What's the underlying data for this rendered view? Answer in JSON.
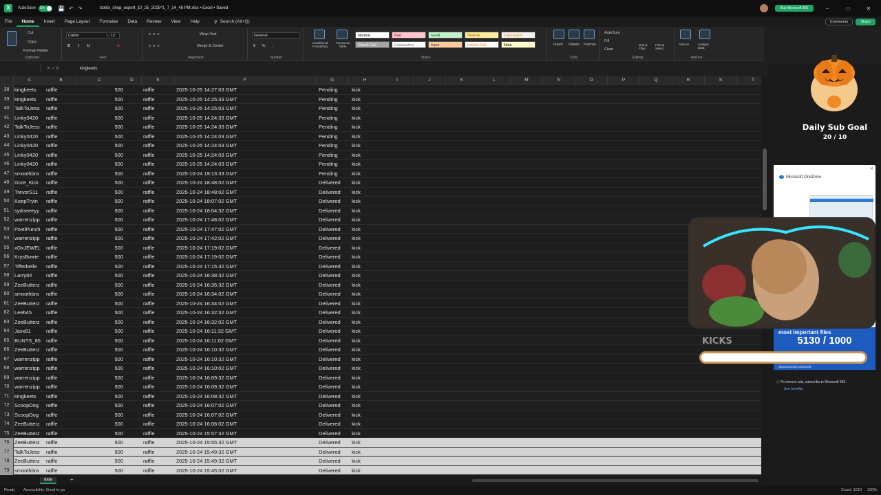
{
  "titlebar": {
    "autosave": "AutoSave",
    "toggle": "On",
    "filename": "botrix_shop_export_10_25_2025^1_7_14_48 PM.xlsx • Excel • Saved",
    "buy": "Buy Microsoft 365",
    "min": "–",
    "max": "□",
    "close": "✕"
  },
  "menu": {
    "tabs": [
      "File",
      "Home",
      "Insert",
      "Page Layout",
      "Formulas",
      "Data",
      "Review",
      "View",
      "Help"
    ],
    "active": "Home",
    "search_placeholder": "Search (Alt+Q)",
    "comments": "Comments",
    "share": "Share"
  },
  "ribbon": {
    "clipboard": {
      "label": "Clipboard",
      "cut": "Cut",
      "copy": "Copy",
      "format_painter": "Format Painter"
    },
    "font": {
      "label": "Font",
      "name": "Calibri",
      "size": "12"
    },
    "alignment": {
      "label": "Alignment",
      "wrap": "Wrap Text",
      "merge": "Merge & Center"
    },
    "number": {
      "label": "Number",
      "format": "General"
    },
    "styles": {
      "label": "Styles",
      "conditional": "Conditional Formatting",
      "format_table": "Format as Table",
      "cells": [
        {
          "name": "Normal",
          "bg": "#ffffff",
          "fg": "#000000"
        },
        {
          "name": "Bad",
          "bg": "#ffc7ce",
          "fg": "#9c0006"
        },
        {
          "name": "Good",
          "bg": "#c6efce",
          "fg": "#006100"
        },
        {
          "name": "Neutral",
          "bg": "#ffeb9c",
          "fg": "#9c5700"
        },
        {
          "name": "Calculation",
          "bg": "#f2f2f2",
          "fg": "#fa7d00"
        },
        {
          "name": "Check Cell",
          "bg": "#a5a5a5",
          "fg": "#ffffff"
        },
        {
          "name": "Explanatory ...",
          "bg": "#ffffff",
          "fg": "#7f7f7f"
        },
        {
          "name": "Input",
          "bg": "#ffcc99",
          "fg": "#3f3f76"
        },
        {
          "name": "Linked Cell",
          "bg": "#ffffff",
          "fg": "#fa7d00"
        },
        {
          "name": "Note",
          "bg": "#ffffcc",
          "fg": "#000000"
        }
      ]
    },
    "cells": {
      "label": "Cells",
      "insert": "Insert",
      "delete": "Delete",
      "format": "Format"
    },
    "editing": {
      "label": "Editing",
      "autosum": "AutoSum",
      "fill": "Fill",
      "clear": "Clear",
      "sort": "Sort & Filter",
      "find": "Find & Select"
    },
    "addins": {
      "label": "Add-ins",
      "addins": "Add-ins",
      "analyze": "Analyze Data"
    }
  },
  "formula": {
    "namebox": "",
    "value": "kingkeets"
  },
  "columns": [
    "A",
    "B",
    "C",
    "D",
    "E",
    "F",
    "G",
    "H",
    "I",
    "J",
    "K",
    "L",
    "M",
    "N",
    "O",
    "P",
    "Q",
    "R",
    "S",
    "T"
  ],
  "rows": [
    {
      "n": "38",
      "a": "kingkeets",
      "b": "raffle",
      "d": "500",
      "e": "raffle",
      "f": "2025-10-25 14:27:03 GMT",
      "g": "Pending",
      "h": "kick"
    },
    {
      "n": "39",
      "a": "kingkeets",
      "b": "raffle",
      "d": "500",
      "e": "raffle",
      "f": "2025-10-25 14:25:33 GMT",
      "g": "Pending",
      "h": "kick"
    },
    {
      "n": "40",
      "a": "TalkToJess",
      "b": "raffle",
      "d": "500",
      "e": "raffle",
      "f": "2025-10-25 14:25:03 GMT",
      "g": "Pending",
      "h": "kick"
    },
    {
      "n": "41",
      "a": "Linky0420",
      "b": "raffle",
      "d": "500",
      "e": "raffle",
      "f": "2025-10-25 14:24:33 GMT",
      "g": "Pending",
      "h": "kick"
    },
    {
      "n": "42",
      "a": "TalkToJess",
      "b": "raffle",
      "d": "500",
      "e": "raffle",
      "f": "2025-10-25 14:24:33 GMT",
      "g": "Pending",
      "h": "kick"
    },
    {
      "n": "43",
      "a": "Linky0420",
      "b": "raffle",
      "d": "500",
      "e": "raffle",
      "f": "2025-10-25 14:24:03 GMT",
      "g": "Pending",
      "h": "kick"
    },
    {
      "n": "44",
      "a": "Linky0420",
      "b": "raffle",
      "d": "500",
      "e": "raffle",
      "f": "2025-10-25 14:24:03 GMT",
      "g": "Pending",
      "h": "kick"
    },
    {
      "n": "45",
      "a": "Linky0420",
      "b": "raffle",
      "d": "500",
      "e": "raffle",
      "f": "2025-10-25 14:24:03 GMT",
      "g": "Pending",
      "h": "kick"
    },
    {
      "n": "46",
      "a": "Linky0420",
      "b": "raffle",
      "d": "500",
      "e": "raffle",
      "f": "2025-10-25 14:24:03 GMT",
      "g": "Pending",
      "h": "kick"
    },
    {
      "n": "47",
      "a": "smoothbra",
      "b": "raffle",
      "d": "500",
      "e": "raffle",
      "f": "2025-10-24 19:13:33 GMT",
      "g": "Pending",
      "h": "kick"
    },
    {
      "n": "48",
      "a": "Gore_Kick",
      "b": "raffle",
      "d": "500",
      "e": "raffle",
      "f": "2025-10-24 18:48:02 GMT",
      "g": "Delivered",
      "h": "kick"
    },
    {
      "n": "49",
      "a": "TrevorS11",
      "b": "raffle",
      "d": "500",
      "e": "raffle",
      "f": "2025-10-24 18:48:02 GMT",
      "g": "Delivered",
      "h": "kick"
    },
    {
      "n": "50",
      "a": "KeepTryin",
      "b": "raffle",
      "d": "500",
      "e": "raffle",
      "f": "2025-10-24 18:07:02 GMT",
      "g": "Delivered",
      "h": "kick"
    },
    {
      "n": "51",
      "a": "sydneeeyy",
      "b": "raffle",
      "d": "500",
      "e": "raffle",
      "f": "2025-10-24 18:04:32 GMT",
      "g": "Delivered",
      "h": "kick"
    },
    {
      "n": "52",
      "a": "warrenzipp",
      "b": "raffle",
      "d": "500",
      "e": "raffle",
      "f": "2025-10-24 17:48:02 GMT",
      "g": "Delivered",
      "h": "kick"
    },
    {
      "n": "53",
      "a": "PixelPunch",
      "b": "raffle",
      "d": "500",
      "e": "raffle",
      "f": "2025-10-24 17:47:02 GMT",
      "g": "Delivered",
      "h": "kick"
    },
    {
      "n": "54",
      "a": "warrenzipp",
      "b": "raffle",
      "d": "500",
      "e": "raffle",
      "f": "2025-10-24 17:42:02 GMT",
      "g": "Delivered",
      "h": "kick"
    },
    {
      "n": "55",
      "a": "xOxJEWEL",
      "b": "raffle",
      "d": "500",
      "e": "raffle",
      "f": "2025-10-24 17:19:02 GMT",
      "g": "Delivered",
      "h": "kick"
    },
    {
      "n": "56",
      "a": "KrysBowie",
      "b": "raffle",
      "d": "500",
      "e": "raffle",
      "f": "2025-10-24 17:19:02 GMT",
      "g": "Delivered",
      "h": "kick"
    },
    {
      "n": "57",
      "a": "Tifferbelle",
      "b": "raffle",
      "d": "500",
      "e": "raffle",
      "f": "2025-10-24 17:15:32 GMT",
      "g": "Delivered",
      "h": "kick"
    },
    {
      "n": "58",
      "a": "Larry84",
      "b": "raffle",
      "d": "500",
      "e": "raffle",
      "f": "2025-10-24 16:38:32 GMT",
      "g": "Delivered",
      "h": "kick"
    },
    {
      "n": "59",
      "a": "ZeeButterz",
      "b": "raffle",
      "d": "500",
      "e": "raffle",
      "f": "2025-10-24 16:35:32 GMT",
      "g": "Delivered",
      "h": "kick"
    },
    {
      "n": "60",
      "a": "smoothbra",
      "b": "raffle",
      "d": "500",
      "e": "raffle",
      "f": "2025-10-24 16:34:02 GMT",
      "g": "Delivered",
      "h": "kick"
    },
    {
      "n": "61",
      "a": "ZeeButterz",
      "b": "raffle",
      "d": "500",
      "e": "raffle",
      "f": "2025-10-24 16:34:02 GMT",
      "g": "Delivered",
      "h": "kick"
    },
    {
      "n": "62",
      "a": "Leeb45",
      "b": "raffle",
      "d": "500",
      "e": "raffle",
      "f": "2025-10-24 16:32:32 GMT",
      "g": "Delivered",
      "h": "kick"
    },
    {
      "n": "63",
      "a": "ZeeButterz",
      "b": "raffle",
      "d": "500",
      "e": "raffle",
      "f": "2025-10-24 16:32:02 GMT",
      "g": "Delivered",
      "h": "kick"
    },
    {
      "n": "64",
      "a": "Jaxx81",
      "b": "raffle",
      "d": "500",
      "e": "raffle",
      "f": "2025-10-24 16:11:32 GMT",
      "g": "Delivered",
      "h": "kick"
    },
    {
      "n": "65",
      "a": "BUNTS_85",
      "b": "raffle",
      "d": "500",
      "e": "raffle",
      "f": "2025-10-24 16:11:02 GMT",
      "g": "Delivered",
      "h": "kick"
    },
    {
      "n": "66",
      "a": "ZeeButterz",
      "b": "raffle",
      "d": "500",
      "e": "raffle",
      "f": "2025-10-24 16:10:32 GMT",
      "g": "Delivered",
      "h": "kick"
    },
    {
      "n": "67",
      "a": "warrenzipp",
      "b": "raffle",
      "d": "500",
      "e": "raffle",
      "f": "2025-10-24 16:10:32 GMT",
      "g": "Delivered",
      "h": "kick"
    },
    {
      "n": "68",
      "a": "warrenzipp",
      "b": "raffle",
      "d": "500",
      "e": "raffle",
      "f": "2025-10-24 16:10:02 GMT",
      "g": "Delivered",
      "h": "kick"
    },
    {
      "n": "69",
      "a": "warrenzipp",
      "b": "raffle",
      "d": "500",
      "e": "raffle",
      "f": "2025-10-24 16:09:32 GMT",
      "g": "Delivered",
      "h": "kick"
    },
    {
      "n": "70",
      "a": "warrenzipp",
      "b": "raffle",
      "d": "500",
      "e": "raffle",
      "f": "2025-10-24 16:09:32 GMT",
      "g": "Delivered",
      "h": "kick"
    },
    {
      "n": "71",
      "a": "kingkeets",
      "b": "raffle",
      "d": "500",
      "e": "raffle",
      "f": "2025-10-24 16:08:32 GMT",
      "g": "Delivered",
      "h": "kick"
    },
    {
      "n": "72",
      "a": "ScoopDog",
      "b": "raffle",
      "d": "500",
      "e": "raffle",
      "f": "2025-10-24 16:07:02 GMT",
      "g": "Delivered",
      "h": "kick"
    },
    {
      "n": "73",
      "a": "ScoopDog",
      "b": "raffle",
      "d": "500",
      "e": "raffle",
      "f": "2025-10-24 16:07:02 GMT",
      "g": "Delivered",
      "h": "kick"
    },
    {
      "n": "74",
      "a": "ZeeButterz",
      "b": "raffle",
      "d": "500",
      "e": "raffle",
      "f": "2025-10-24 16:06:02 GMT",
      "g": "Delivered",
      "h": "kick"
    },
    {
      "n": "75",
      "a": "ZeeButterz",
      "b": "raffle",
      "d": "500",
      "e": "raffle",
      "f": "2025-10-24 15:57:32 GMT",
      "g": "Delivered",
      "h": "kick"
    },
    {
      "n": "76",
      "a": "ZeeButterz",
      "b": "raffle",
      "d": "500",
      "e": "raffle",
      "f": "2025-10-24 15:55:32 GMT",
      "g": "Delivered",
      "h": "kick",
      "sel": true
    },
    {
      "n": "77",
      "a": "TalkToJess",
      "b": "raffle",
      "d": "500",
      "e": "raffle",
      "f": "2025-10-24 15:49:32 GMT",
      "g": "Delivered",
      "h": "kick",
      "sel": true
    },
    {
      "n": "78",
      "a": "ZeeButterz",
      "b": "raffle",
      "d": "500",
      "e": "raffle",
      "f": "2025-10-24 15:49:32 GMT",
      "g": "Delivered",
      "h": "kick",
      "sel": true
    },
    {
      "n": "79",
      "a": "smoothbra",
      "b": "raffle",
      "d": "500",
      "e": "raffle",
      "f": "2025-10-24 15:45:02 GMT",
      "g": "Delivered",
      "h": "kick",
      "sel": true
    }
  ],
  "sheet": {
    "tab": "data",
    "add": "+"
  },
  "status": {
    "ready": "Ready",
    "accessibility": "Accessibility: Good to go",
    "count": "Count: 1010",
    "zoom": "130%"
  },
  "overlay": {
    "sub_goal_title": "Daily Sub Goal",
    "sub_goal_value": "20 / 10",
    "onedrive_title": "Microsoft OneDrive",
    "onedrive_caption": "most important files",
    "kick_count": "5130 / 1000",
    "sponsored": "Sponsored by Microsoft",
    "ad_note": "To remove ads, subscribe to Microsoft 365.",
    "see_benefits": "See benefits",
    "kicks_label": "KICKS"
  }
}
